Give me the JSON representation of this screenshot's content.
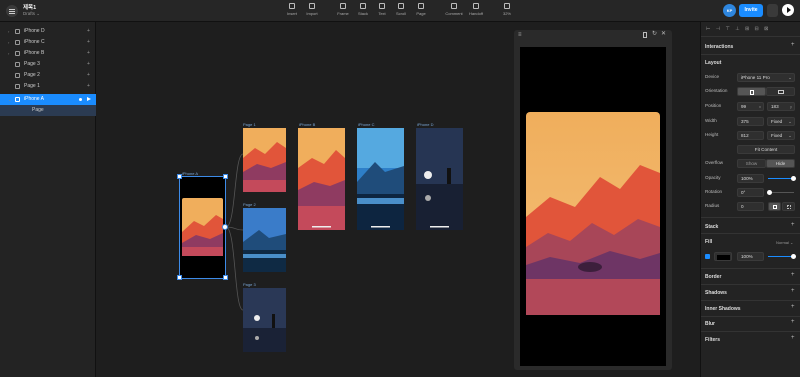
{
  "topbar": {
    "project": "제목1",
    "subtitle": "Drafts ⌄",
    "tools": [
      {
        "label": "Insert",
        "icon": "plus-icon"
      },
      {
        "label": "Import",
        "icon": "download-icon"
      },
      {
        "label": "Frame",
        "icon": "frame-icon"
      },
      {
        "label": "Stack",
        "icon": "stack-icon"
      },
      {
        "label": "Text",
        "icon": "text-icon"
      },
      {
        "label": "Scroll",
        "icon": "scroll-icon"
      },
      {
        "label": "Page",
        "icon": "page-icon"
      },
      {
        "label": "Comment",
        "icon": "comment-icon"
      },
      {
        "label": "Handoff",
        "icon": "handoff-icon"
      },
      {
        "label": "32%",
        "icon": "zoom-icon"
      }
    ],
    "avatar": "KP",
    "invite": "Invite"
  },
  "layers": [
    "iPhone D",
    "iPhone C",
    "iPhone B",
    "Page 3",
    "Page 2",
    "Page 1",
    "iPhone A",
    "Page"
  ],
  "canvas": {
    "labels": [
      "iPhone A",
      "Page 1",
      "iPhone B",
      "iPhone C",
      "iPhone D",
      "Page 2",
      "Page 3"
    ]
  },
  "colors": {
    "accent": "#1a8cff",
    "sky": "#f2b15a",
    "mountain_red": "#e1553a",
    "mountain_purple": "#7a3a6c",
    "night": "#263553"
  },
  "panel": {
    "interactions": "Interactions",
    "layout": "Layout",
    "device_label": "Device",
    "device": "iPhone 11 Pro",
    "orientation_label": "Orientation",
    "position_label": "Position",
    "x": "99",
    "y": "183",
    "width_label": "Width",
    "width": "375",
    "width_mode": "Fixed",
    "height_label": "Height",
    "height": "812",
    "height_mode": "Fixed",
    "fit_content": "Fit Content",
    "overflow_label": "Overflow",
    "show": "Show",
    "hide": "Hide",
    "opacity_label": "Opacity",
    "opacity": "100%",
    "opacity_value": 1.0,
    "rotation_label": "Rotation",
    "rotation": "0°",
    "radius_label": "Radius",
    "radius": "0",
    "stack": "Stack",
    "fill": "Fill",
    "fill_mode": "Normal ⌄",
    "fill_opacity": "100%",
    "border": "Border",
    "shadows": "Shadows",
    "inner_shadows": "Inner Shadows",
    "blur": "Blur",
    "filters": "Filters"
  }
}
